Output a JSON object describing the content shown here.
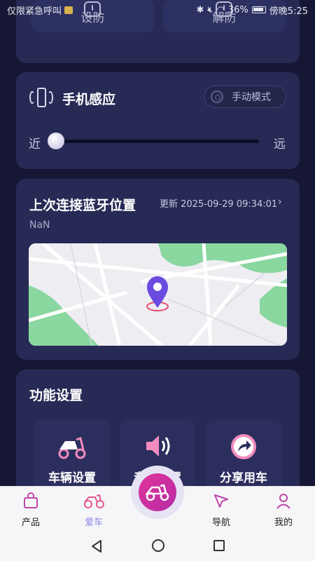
{
  "status_bar": {
    "carrier_text": "仅限紧急呼叫",
    "battery": "36%",
    "time": "傍晚5:25"
  },
  "security_card": {
    "arm_label": "设防",
    "disarm_label": "解防"
  },
  "proximity_card": {
    "title": "手机感应",
    "mode_label": "手动模式",
    "near_label": "近",
    "far_label": "远",
    "sensitivity_level": 0.0
  },
  "location_card": {
    "title": "上次连接蓝牙位置",
    "update_label": "更新 2025-09-29 09:34:01",
    "coordinates": "NaN"
  },
  "feature_card": {
    "title": "功能设置",
    "items": [
      {
        "label": "车辆设置",
        "icon": "scooter-icon"
      },
      {
        "label": "音效设置",
        "icon": "speaker-icon"
      },
      {
        "label": "分享用车",
        "icon": "share-icon"
      }
    ]
  },
  "bottom_nav": {
    "items": [
      {
        "label": "产品",
        "icon": "shopping-bag-icon"
      },
      {
        "label": "爱车",
        "icon": "scooter-icon",
        "active": true
      },
      {
        "label": "导航",
        "icon": "navigation-icon"
      },
      {
        "label": "我的",
        "icon": "user-icon"
      }
    ],
    "center_icon": "scooter-icon"
  },
  "colors": {
    "background": "#151734",
    "card": "#272a55",
    "accent": "#8a86e8",
    "center_button": "#e0349a"
  }
}
